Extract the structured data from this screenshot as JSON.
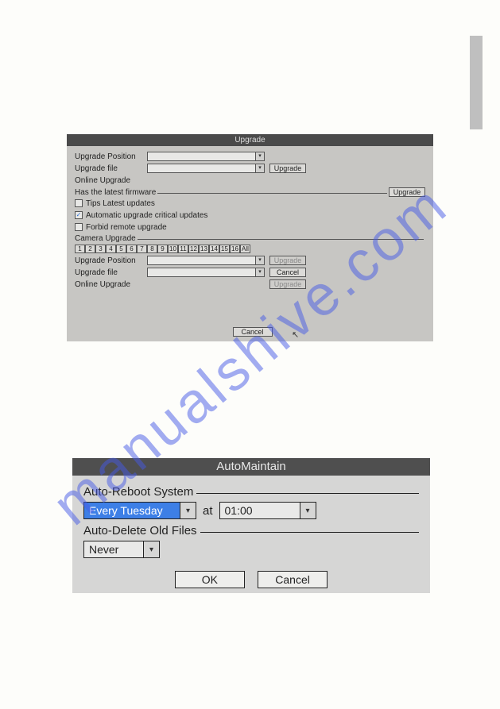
{
  "watermark": "manualshive.com",
  "dialog1": {
    "title": "Upgrade",
    "rows": {
      "upgrade_position": "Upgrade Position",
      "upgrade_file": "Upgrade file",
      "online_upgrade": "Online Upgrade",
      "upgrade_btn": "Upgrade",
      "cancel_btn": "Cancel"
    },
    "firmware_section": "Has the latest firmware",
    "checks": {
      "tips": "Tips Latest updates",
      "auto_crit": "Automatic upgrade critical updates",
      "forbid": "Forbid remote upgrade"
    },
    "camera_section": "Camera Upgrade",
    "channels": [
      "1",
      "2",
      "3",
      "4",
      "5",
      "6",
      "7",
      "8",
      "9",
      "10",
      "11",
      "12",
      "13",
      "14",
      "15",
      "16",
      "All"
    ],
    "footer_cancel": "Cancel"
  },
  "dialog2": {
    "title": "AutoMaintain",
    "section_reboot": "Auto-Reboot System",
    "day_value": "Every Tuesday",
    "at_label": "at",
    "time_value": "01:00",
    "section_delete": "Auto-Delete Old Files",
    "delete_value": "Never",
    "ok": "OK",
    "cancel": "Cancel"
  }
}
